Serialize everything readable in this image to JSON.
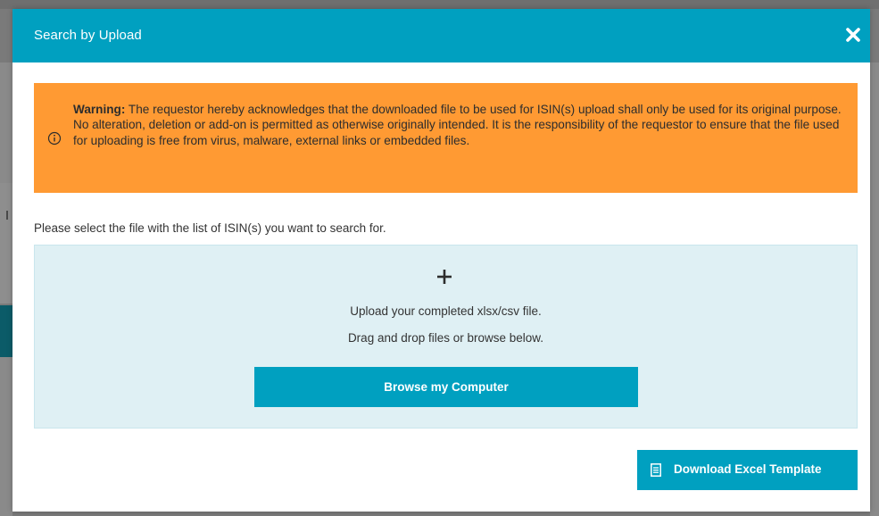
{
  "dialog": {
    "title": "Search by Upload",
    "close_icon": "close-icon"
  },
  "warning": {
    "label": "Warning:",
    "text": " The requestor hereby acknowledges that the downloaded file to be used for ISIN(s) upload shall only be used for its original purpose. No alteration, deletion or add-on is permitted as otherwise originally intended. It is the responsibility of the requestor to ensure that the file used for uploading is free from virus, malware, external links or embedded files.",
    "icon": "info-icon"
  },
  "instruction": "Please select the file with the list of ISIN(s) you want to search for.",
  "dropzone": {
    "icon": "plus-icon",
    "line1": "Upload your completed xlsx/csv file.",
    "line2": "Drag and drop files or browse below.",
    "browse_label": "Browse my Computer"
  },
  "download": {
    "icon": "document-icon",
    "label": "Download Excel Template"
  },
  "colors": {
    "accent": "#00a0c0",
    "warning": "#ff9a33",
    "dropzone": "#dff0f4",
    "text": "#333333"
  }
}
